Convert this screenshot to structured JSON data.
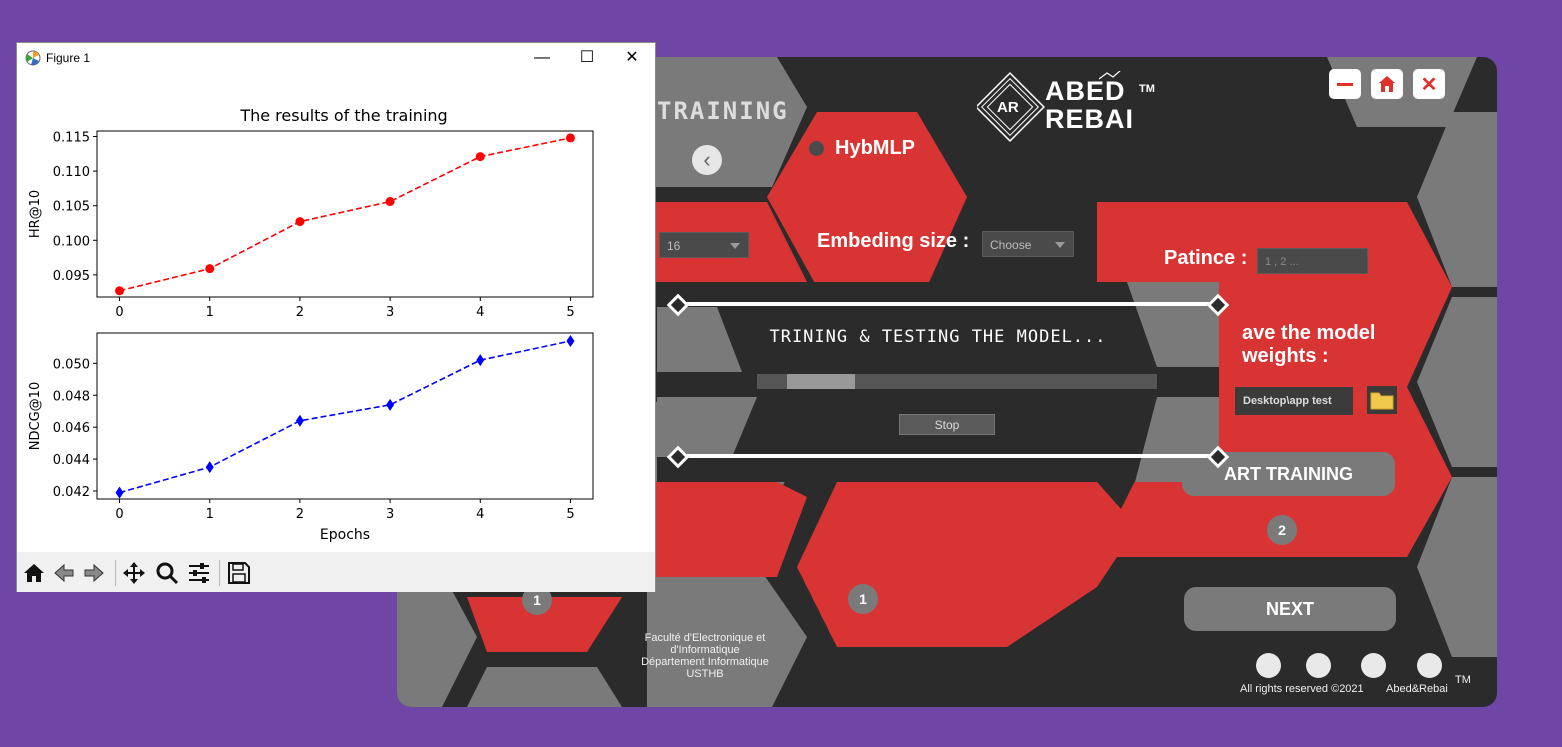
{
  "app": {
    "window_buttons": [
      {
        "name": "minimize-icon"
      },
      {
        "name": "home-icon"
      },
      {
        "name": "close-icon"
      }
    ],
    "logo": {
      "initials": "AR",
      "line1": "ABED",
      "line2": "REBAI",
      "tm": "TM"
    },
    "section_title": "TRAINING",
    "model_name": "HybMLP",
    "embeding_label": "Embeding size :",
    "embeding_value": "Choose",
    "batch_value": "16",
    "patince_label": "Patince :",
    "patince_placeholder": "1 , 2 ...",
    "save_label_line1": "ave the model",
    "save_label_line2": "weights :",
    "save_path": "Desktop\\app test",
    "start_button": "ART TRAINING",
    "next_button": "NEXT",
    "step_numbers": [
      "1",
      "1",
      "2"
    ],
    "footer_faculty": [
      "Faculté d'Electronique et",
      "d'Informatique",
      "Département Informatique",
      "USTHB"
    ],
    "rights": "All rights reserved ©2021",
    "brand": "Abed&Rebai",
    "brand_tm": "TM",
    "accent_red": "#d93434",
    "panel_gray": "#7a7a7a"
  },
  "progress": {
    "title": "TRINING & TESTING THE MODEL...",
    "stop_label": "Stop",
    "level": 0.17
  },
  "figure": {
    "window_title": "Figure 1",
    "toolbar": [
      "home-icon",
      "back-arrow-icon",
      "forward-arrow-icon",
      "pan-icon",
      "zoom-icon",
      "configure-subplots-icon",
      "save-icon"
    ]
  },
  "chart_data": {
    "type": "line",
    "title": "The results of the training",
    "xlabel": "Epochs",
    "x": [
      0,
      1,
      2,
      3,
      4,
      5
    ],
    "subplots": [
      {
        "ylabel": "HR@10",
        "color": "#ff0000",
        "marker": "circle",
        "ylim": [
          0.0918,
          0.1158
        ],
        "yticks": [
          "0.095",
          "0.100",
          "0.105",
          "0.110",
          "0.115"
        ],
        "ytick_values": [
          0.095,
          0.1,
          0.105,
          0.11,
          0.115
        ],
        "values": [
          0.0927,
          0.0959,
          0.1027,
          0.1056,
          0.1121,
          0.1148
        ]
      },
      {
        "ylabel": "NDCG@10",
        "color": "#0000ff",
        "marker": "diamond",
        "ylim": [
          0.0415,
          0.0519
        ],
        "yticks": [
          "0.042",
          "0.044",
          "0.046",
          "0.048",
          "0.050"
        ],
        "ytick_values": [
          0.042,
          0.044,
          0.046,
          0.048,
          0.05
        ],
        "values": [
          0.0419,
          0.0435,
          0.0464,
          0.0474,
          0.0502,
          0.0514
        ]
      }
    ],
    "xticks": [
      "0",
      "1",
      "2",
      "3",
      "4",
      "5"
    ],
    "grid": false
  }
}
